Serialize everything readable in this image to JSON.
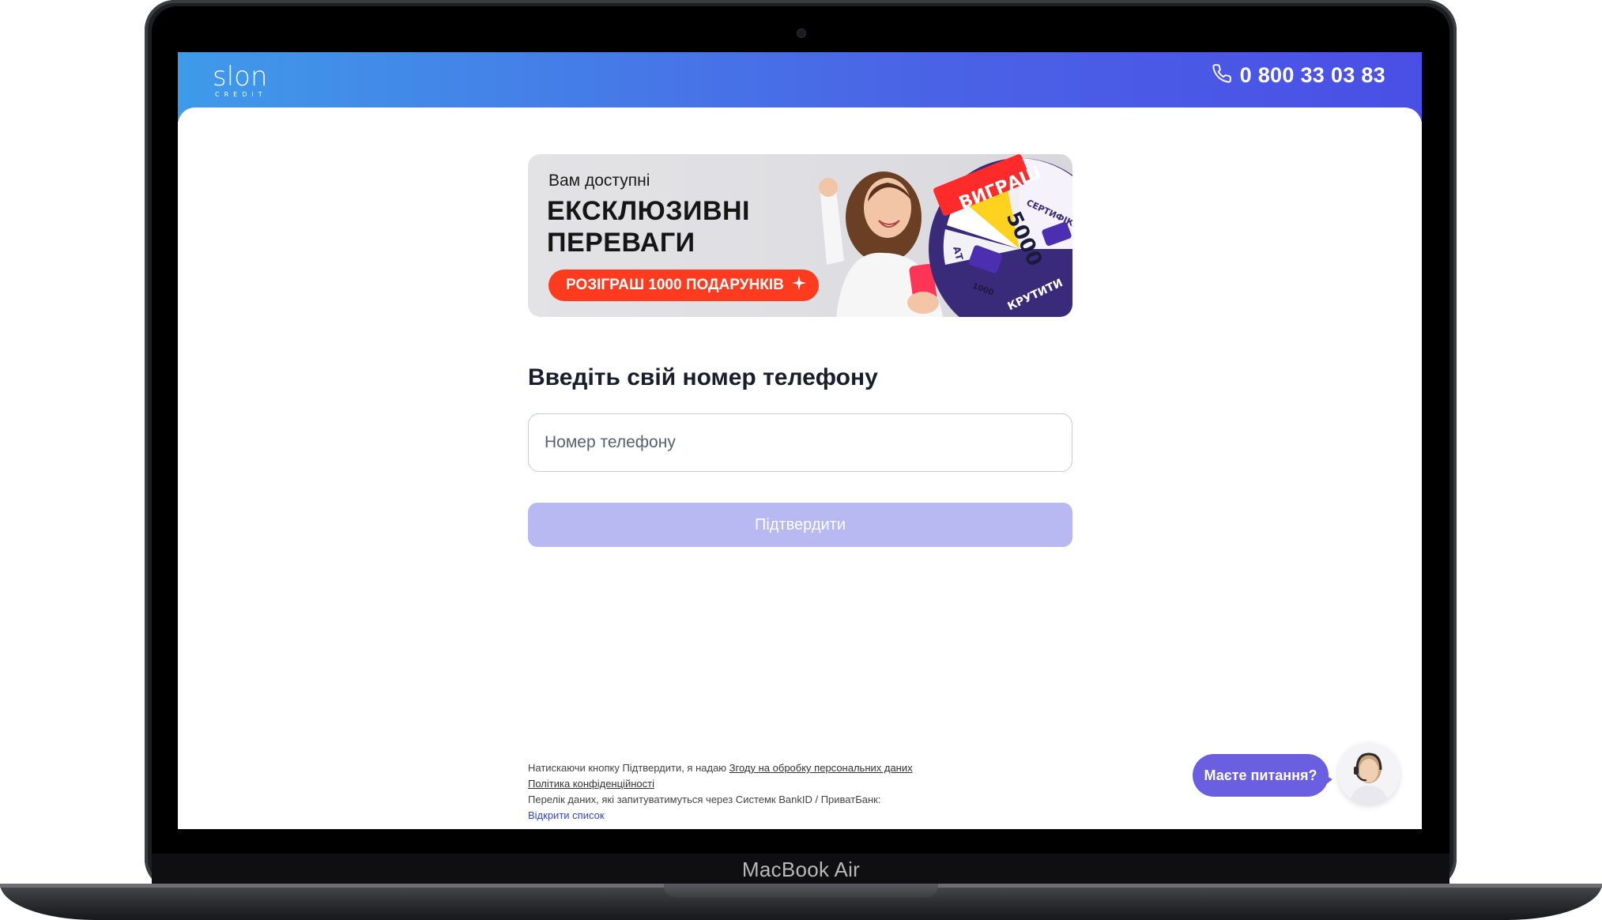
{
  "device": {
    "label": "MacBook Air"
  },
  "header": {
    "logo_text": "slon",
    "logo_sub": "CREDIT",
    "phone": "0 800 33 03 83"
  },
  "banner": {
    "subtitle": "Вам доступні",
    "title_line1": "ЕКСКЛЮЗИВНІ",
    "title_line2": "ПЕРЕВАГИ",
    "pill": "РОЗІГРАШ 1000 ПОДАРУНКІВ",
    "wheel_win": "ВИГРАШ",
    "wheel_amount": "5000",
    "wheel_cert": "СЕРТИФІКАТ",
    "wheel_spin": "КРУТИТИ",
    "wheel_small": "1000",
    "wheel_partial": "000",
    "wheel_partial2": "АТ"
  },
  "form": {
    "heading": "Введіть свій номер телефону",
    "phone_placeholder": "Номер телефону",
    "submit_label": "Підтвердити"
  },
  "legal": {
    "consent_prefix": "Натискаючи кнопку Підтвердити, я надаю ",
    "consent_link": "Згоду на обробку персональних даних",
    "privacy_link": "Політика конфіденційності",
    "bankid_text": "Перелік даних, які запитуватимуться через Системк BankID / ПриватБанк:",
    "open_list": "Відкрити список"
  },
  "chat": {
    "label": "Маєте питання?"
  },
  "colors": {
    "header_start": "#3f9ae9",
    "header_end": "#4a4fe6",
    "button_disabled": "#b8b9f3",
    "pill": "#ff3b1f",
    "chat": "#6a5fe0"
  }
}
